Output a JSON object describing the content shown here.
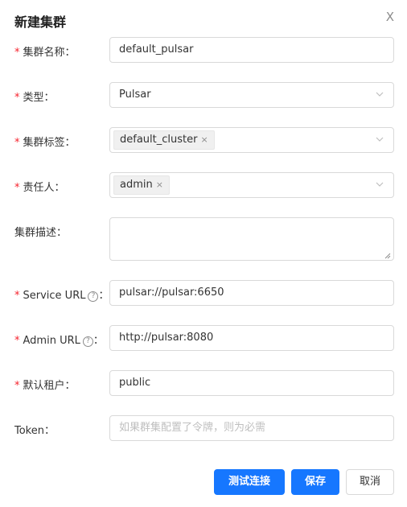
{
  "dialog": {
    "title": "新建集群",
    "close_glyph": "X"
  },
  "fields": {
    "cluster_name": {
      "label": "集群名称：",
      "value": "default_pulsar"
    },
    "type": {
      "label": "类型：",
      "value": "Pulsar"
    },
    "cluster_tags": {
      "label": "集群标签：",
      "tag": "default_cluster",
      "tag_remove": "×"
    },
    "owner": {
      "label": "责任人：",
      "tag": "admin",
      "tag_remove": "×"
    },
    "description": {
      "label": "集群描述：",
      "value": ""
    },
    "service_url": {
      "label": "Service URL",
      "help": "?",
      "colon": "：",
      "value": "pulsar://pulsar:6650"
    },
    "admin_url": {
      "label": "Admin URL",
      "help": "?",
      "colon": "：",
      "value": "http://pulsar:8080"
    },
    "default_tenant": {
      "label": "默认租户：",
      "value": "public"
    },
    "token": {
      "label": "Token：",
      "placeholder": "如果群集配置了令牌，则为必需"
    }
  },
  "required_mark": "*",
  "buttons": {
    "test": "测试连接",
    "save": "保存",
    "cancel": "取消"
  },
  "colors": {
    "primary": "#1677ff",
    "required": "#f5222d",
    "border": "#d9d9d9"
  }
}
